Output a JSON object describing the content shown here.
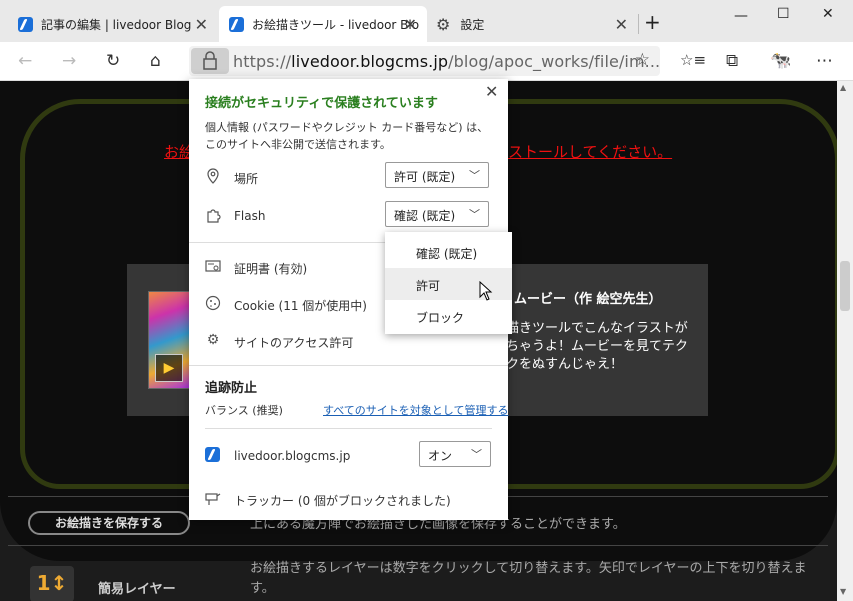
{
  "browser": {
    "tabs": [
      {
        "title": "記事の編集 | livedoor Blog",
        "active": false
      },
      {
        "title": "お絵描きツール - livedoor Blo",
        "active": true
      },
      {
        "title": "設定",
        "active": false
      }
    ],
    "new_tab": "+",
    "window": {
      "minimize": "—",
      "maximize": "☐",
      "close": "✕"
    },
    "toolbar": {
      "url_scheme": "https://",
      "url_domain": "livedoor.blogcms.jp",
      "url_path": "/blog/apoc_works/file/im..."
    }
  },
  "page": {
    "warning_left": "お絵",
    "warning_right": "ストールしてください。",
    "movie_title": "ムービー（作 絵空先生）",
    "movie_lines": [
      "描きツールでこんなイラストが",
      "ちゃうよ！ムービーを見てテク",
      "クをぬすんじゃえ！"
    ],
    "save_button": "お絵描きを保存する",
    "save_desc": "上にある魔方陣でお絵描きした画像を保存することができます。",
    "layer_desc_1": "お絵描きするレイヤーは数字をクリックして切り替えます。矢印でレイヤーの上下を切り替えま",
    "layer_desc_2": "す。",
    "layer_label": "簡易レイヤー"
  },
  "popup": {
    "title": "接続がセキュリティで保護されています",
    "description": "個人情報 (パスワードやクレジット カード番号など) は、このサイトへ非公開で送信されます。",
    "permissions": [
      {
        "label": "場所",
        "value": "許可 (既定)",
        "icon": "location-pin-icon"
      },
      {
        "label": "Flash",
        "value": "確認 (既定)",
        "icon": "puzzle-icon"
      }
    ],
    "info_rows": [
      {
        "label": "証明書 (有効)",
        "icon": "certificate-icon"
      },
      {
        "label": "Cookie (11 個が使用中)",
        "icon": "cookie-icon"
      },
      {
        "label": "サイトのアクセス許可",
        "icon": "gear-icon"
      }
    ],
    "tracking": {
      "heading": "追跡防止",
      "level": "バランス (推奨)",
      "manage_link": "すべてのサイトを対象として管理する",
      "site": "livedoor.blogcms.jp",
      "site_toggle": "オン",
      "trackers": "トラッカー (0 個がブロックされました)"
    }
  },
  "flash_menu": {
    "options": [
      "確認 (既定)",
      "許可",
      "ブロック"
    ],
    "hovered": "許可"
  },
  "colors": {
    "secure_green": "#2a7f1f",
    "link_blue": "#1a5fb4",
    "warning_red": "#ee1111"
  }
}
